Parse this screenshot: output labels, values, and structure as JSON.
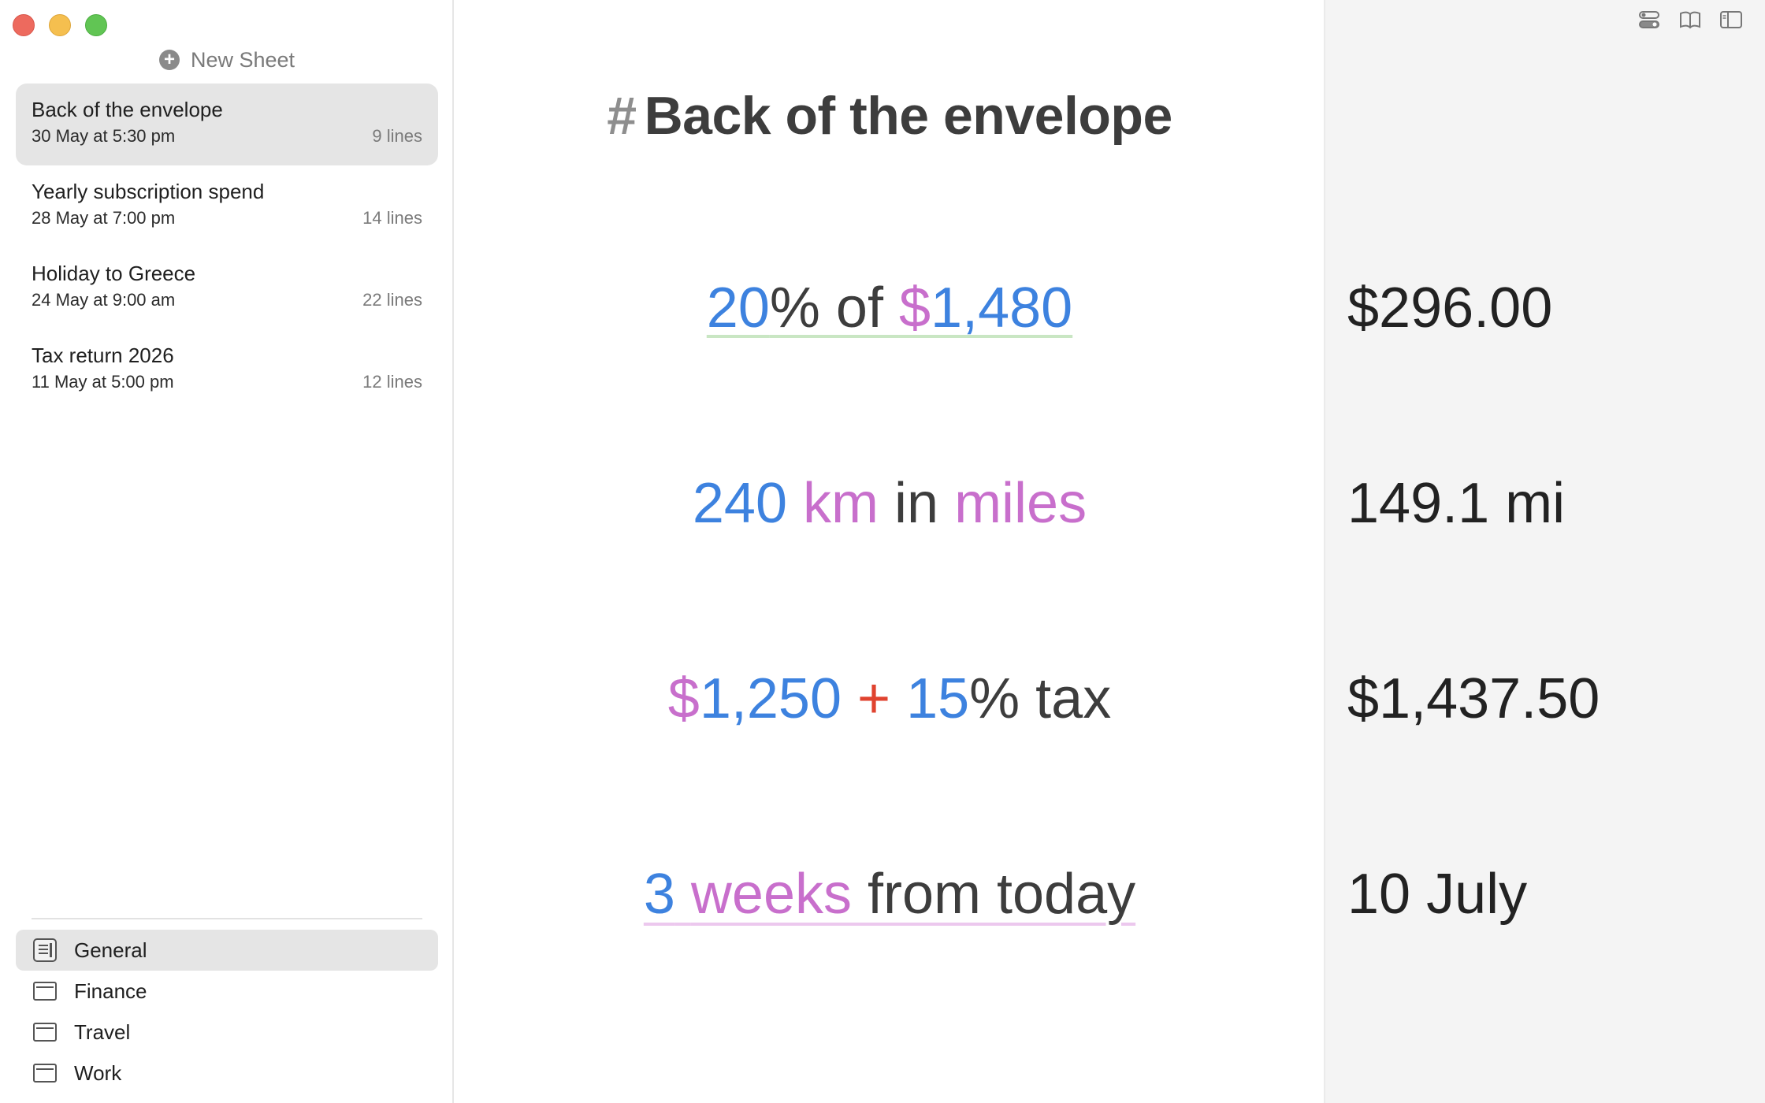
{
  "new_sheet_label": "New Sheet",
  "sheets": [
    {
      "title": "Back of the envelope",
      "date": "30 May at 5:30 pm",
      "lines": "9 lines"
    },
    {
      "title": "Yearly subscription spend",
      "date": "28 May at 7:00 pm",
      "lines": "14 lines"
    },
    {
      "title": "Holiday to Greece",
      "date": "24 May at 9:00 am",
      "lines": "22 lines"
    },
    {
      "title": "Tax return 2026",
      "date": "11 May at 5:00 pm",
      "lines": "12 lines"
    }
  ],
  "groups": [
    {
      "label": "General",
      "icon": "library-icon"
    },
    {
      "label": "Finance",
      "icon": "folder-icon"
    },
    {
      "label": "Travel",
      "icon": "folder-icon"
    },
    {
      "label": "Work",
      "icon": "folder-icon"
    }
  ],
  "editor": {
    "heading_hash": "#",
    "heading": "Back of the envelope",
    "lines": [
      {
        "parts": [
          "20",
          "% of ",
          "$",
          "1,480"
        ]
      },
      {
        "parts": [
          "240",
          " ",
          "km",
          " in ",
          "miles"
        ]
      },
      {
        "parts": [
          "$",
          "1,250",
          " + ",
          "15",
          "% tax"
        ]
      },
      {
        "parts": [
          "3",
          " ",
          "weeks",
          " from today"
        ]
      }
    ]
  },
  "results": [
    "$296.00",
    "149.1 mi",
    "$1,437.50",
    "10 July"
  ],
  "colors": {
    "number": "#3d82df",
    "unit": "#c86fcc",
    "operator": "#e0432f",
    "text": "#3d3d3d"
  },
  "toolbar_icons": [
    "toggle-icon",
    "book-icon",
    "sidebar-icon"
  ]
}
